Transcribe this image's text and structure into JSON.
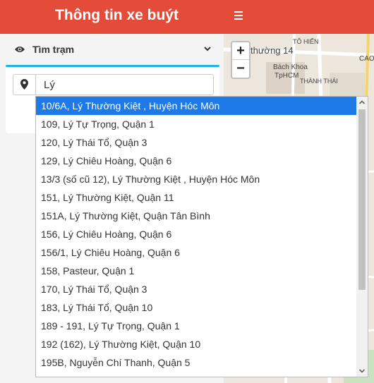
{
  "header": {
    "title": "Thông tin xe buýt",
    "menu_icon": "hamburger-menu-icon",
    "color": "#e44c39"
  },
  "panel": {
    "title": "Tìm trạm",
    "title_icon": "eye-icon",
    "toggle_icon": "chevron-down-icon",
    "accent_color": "#1eb4e8"
  },
  "search": {
    "value": "Lý",
    "icon": "map-marker-icon"
  },
  "map": {
    "zoom_in": "+",
    "zoom_out": "−",
    "labels": {
      "street": "thường 14",
      "poi_line1": "Bách Khoa",
      "poi_line2": "TpHCM",
      "road1": "TÔ HIẾN",
      "road2": "THÀNH THÁI",
      "corner": "CAO"
    }
  },
  "suggestions": {
    "selected_index": 0,
    "selected_color": "#1e7ae6",
    "items": [
      "10/6A, Lý Thường Kiệt , Huyện Hóc Môn",
      "109, Lý Tự Trọng, Quận 1",
      "120, Lý Thái Tổ, Quận 3",
      "129, Lý Chiêu Hoàng, Quận 6",
      "13/3 (số cũ 12), Lý Thường Kiệt , Huyện Hóc Môn",
      "151, Lý Thường Kiệt, Quận 11",
      "151A, Lý Thường Kiệt, Quận Tân Bình",
      "156, Lý Chiêu Hoàng, Quận 6",
      "156/1, Lý Chiêu Hoàng, Quận 6",
      "158, Pasteur, Quận 1",
      "170, Lý Thái Tổ, Quận 3",
      "183, Lý Thái Tổ, Quận 10",
      "189 - 191, Lý Tự Trọng, Quận 1",
      "192 (162), Lý Thường Kiệt, Quận 10",
      "195B, Nguyễn Chí Thanh, Quận 5"
    ]
  }
}
